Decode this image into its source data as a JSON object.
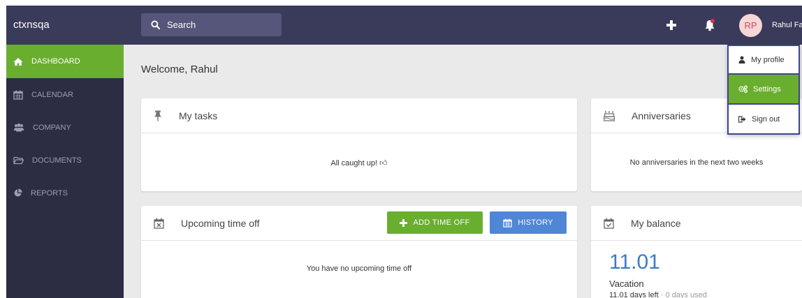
{
  "app": {
    "brand": "ctxnsqa"
  },
  "search": {
    "placeholder": "Search"
  },
  "user": {
    "initials": "RP",
    "name": "Rahul Fa"
  },
  "sidebar": {
    "items": [
      {
        "label": "DASHBOARD",
        "icon": "home-icon",
        "active": true
      },
      {
        "label": "CALENDAR",
        "icon": "calendar-icon"
      },
      {
        "label": "COMPANY",
        "icon": "users-icon"
      },
      {
        "label": "DOCUMENTS",
        "icon": "folder-icon"
      },
      {
        "label": "REPORTS",
        "icon": "pie-chart-icon"
      }
    ]
  },
  "main": {
    "welcome": "Welcome, Rahul",
    "tasks": {
      "title": "My tasks",
      "message": "All caught up! 👍︎"
    },
    "anniversaries": {
      "title": "Anniversaries",
      "message": "No anniversaries in the next two weeks"
    },
    "timeoff": {
      "title": "Upcoming time off",
      "add_label": "ADD TIME OFF",
      "history_label": "HISTORY",
      "message": "You have no upcoming time off"
    },
    "balance": {
      "title": "My balance",
      "value": "11.01",
      "label": "Vacation",
      "days_left": "11.01 days left",
      "sep": " · ",
      "days_used": "0 days used"
    }
  },
  "dropdown": {
    "items": [
      {
        "label": "My profile",
        "icon": "user-icon"
      },
      {
        "label": "Settings",
        "icon": "gears-icon",
        "active": true
      },
      {
        "label": "Sign out",
        "icon": "sign-out-icon"
      }
    ]
  },
  "colors": {
    "topbar": "#3a3b5a",
    "sidebar": "#2c2d43",
    "accent_green": "#6aae2f",
    "accent_blue": "#4f86d6",
    "balance_blue": "#3e7cc4"
  }
}
